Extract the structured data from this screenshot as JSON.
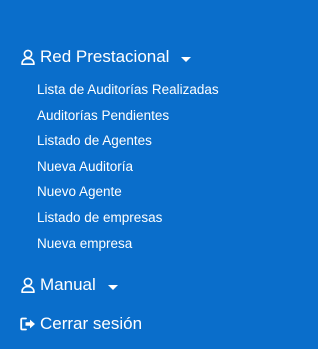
{
  "sidebar": {
    "background": "#0a6ecb",
    "text_color": "#ffffff",
    "red_prestacional": {
      "icon": "user-icon",
      "label": "Red Prestacional",
      "expand_icon": "caret-down-icon",
      "items": [
        {
          "label": "Lista de Auditorías Realizadas"
        },
        {
          "label": "Auditorías Pendientes"
        },
        {
          "label": "Listado de Agentes"
        },
        {
          "label": "Nueva Auditoría"
        },
        {
          "label": "Nuevo Agente"
        },
        {
          "label": "Listado de empresas"
        },
        {
          "label": "Nueva empresa"
        }
      ]
    },
    "manual": {
      "icon": "user-icon",
      "label": "Manual",
      "expand_icon": "caret-down-icon"
    },
    "logout": {
      "icon": "sign-out-icon",
      "label": "Cerrar sesión"
    }
  }
}
